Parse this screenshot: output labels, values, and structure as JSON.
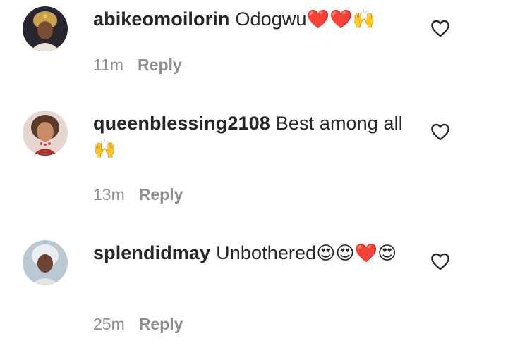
{
  "comments": [
    {
      "username": "abikeomoilorin",
      "text": "Odogwu",
      "emoji": "❤️❤️🙌",
      "time": "11m",
      "reply_label": "Reply"
    },
    {
      "username": "queenblessing2108",
      "text": "Best among all",
      "emoji": "🙌",
      "time": "13m",
      "reply_label": "Reply"
    },
    {
      "username": "splendidmay",
      "text": "Unbothered",
      "emoji": "😍😍❤️😍",
      "time": "25m",
      "reply_label": "Reply"
    }
  ],
  "icons": {
    "like": "heart-outline-icon"
  },
  "colors": {
    "text": "#262626",
    "meta": "#8e8e8e",
    "heart_red": "#e0245e"
  }
}
